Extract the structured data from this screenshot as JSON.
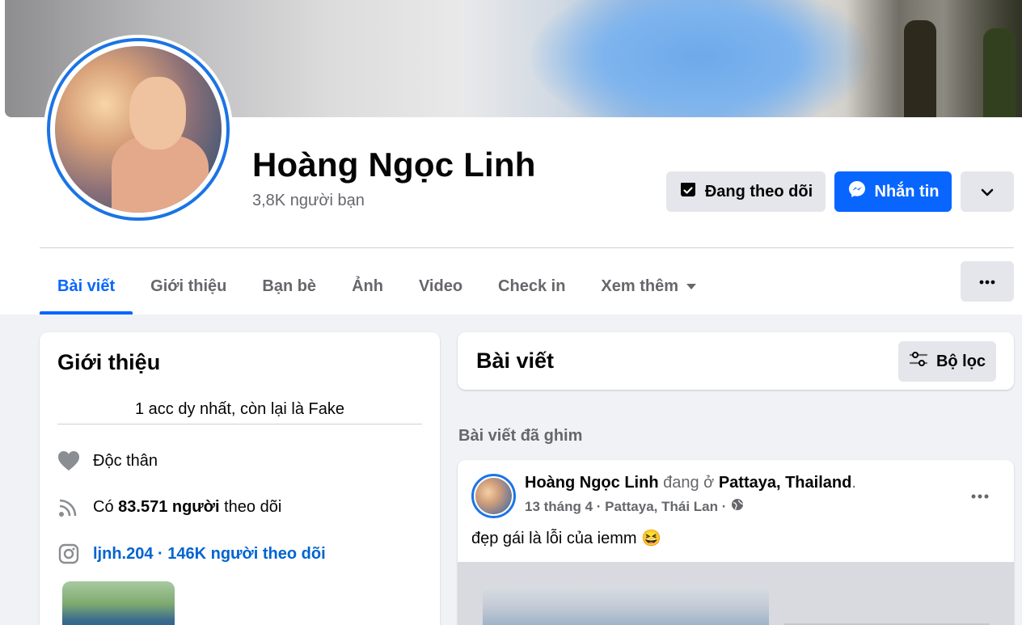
{
  "profile": {
    "name": "Hoàng Ngọc Linh",
    "friends": "3,8K người bạn"
  },
  "actions": {
    "follow_label": "Đang theo dõi",
    "message_label": "Nhắn tin"
  },
  "tabs": [
    {
      "label": "Bài viết",
      "active": true
    },
    {
      "label": "Giới thiệu"
    },
    {
      "label": "Bạn bè"
    },
    {
      "label": "Ảnh"
    },
    {
      "label": "Video"
    },
    {
      "label": "Check in"
    },
    {
      "label": "Xem thêm"
    }
  ],
  "intro": {
    "title": "Giới thiệu",
    "bio": "1 acc dy nhất, còn lại là Fake",
    "relationship": "Độc thân",
    "followers_prefix": "Có",
    "followers_count": "83.571 người",
    "followers_suffix": "theo dõi",
    "instagram": "ljnh.204 · 146K người theo dõi"
  },
  "posts": {
    "title": "Bài viết",
    "filter_label": "Bộ lọc",
    "pinned_label": "Bài viết đã ghim"
  },
  "post": {
    "author": "Hoàng Ngọc Linh",
    "action": " đang ở ",
    "place": "Pattaya, Thailand",
    "date": "13 tháng 4 · Pattaya, Thái Lan ·",
    "text": "đẹp gái là lỗi của iemm 😆"
  },
  "colors": {
    "accent": "#0866ff",
    "secondary_button": "#e4e6eb",
    "page_background": "#f0f2f5",
    "muted_text": "#65676b"
  },
  "icons": {
    "follow": "check-box-icon",
    "message": "messenger-icon",
    "more": "chevron-down-icon",
    "tabs_more": "more-horizontal-icon",
    "relationship": "heart-icon",
    "followers": "rss-icon",
    "instagram": "instagram-icon",
    "filter": "filter-sliders-icon",
    "privacy": "globe-icon"
  }
}
